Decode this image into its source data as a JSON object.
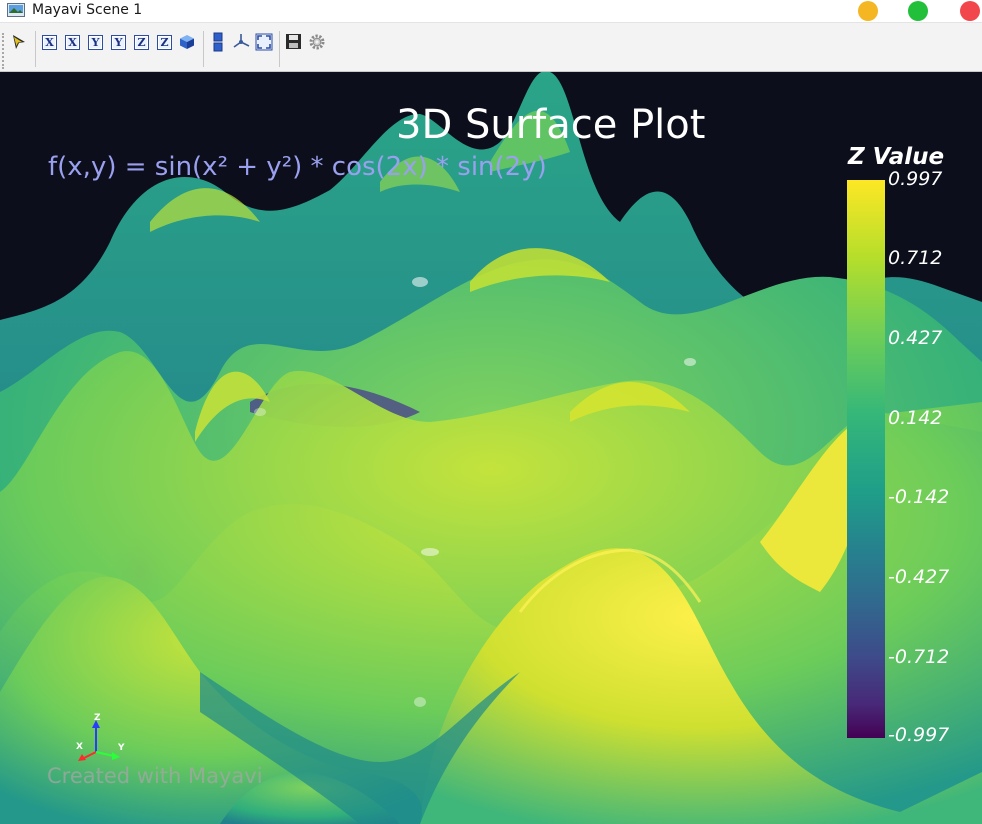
{
  "window": {
    "title": "Mayavi Scene 1"
  },
  "toolbar": {
    "icons": [
      "pointer-icon",
      "view-x-plus-icon",
      "view-x-minus-icon",
      "view-y-plus-icon",
      "view-y-minus-icon",
      "view-z-plus-icon",
      "view-z-minus-icon",
      "isometric-view-icon",
      "parallel-projection-icon",
      "axes-indicator-icon",
      "full-screen-icon",
      "save-icon",
      "settings-icon"
    ],
    "axis_labels": [
      "X",
      "X",
      "Y",
      "Y",
      "Z",
      "Z"
    ]
  },
  "scene": {
    "title": "3D Surface Plot",
    "formula": "f(x,y) = sin(x² + y²) * cos(2x) * sin(2y)",
    "watermark": "Created with Mayavi",
    "colorbar": {
      "title": "Z Value",
      "ticks": [
        "0.997",
        "0.712",
        "0.427",
        "0.142",
        "-0.142",
        "-0.427",
        "-0.712",
        "-0.997"
      ],
      "colormap": [
        "#fde725",
        "#b5de2b",
        "#6ece58",
        "#35b779",
        "#1f9e89",
        "#26828e",
        "#31688e",
        "#3e4989",
        "#482878",
        "#440154"
      ]
    },
    "orientation_axes": {
      "x": "X",
      "y": "Y",
      "z": "Z"
    }
  },
  "colors": {
    "background": "#0c0e1b",
    "title_text": "#ffffff",
    "formula_text": "#9aa0f0"
  }
}
